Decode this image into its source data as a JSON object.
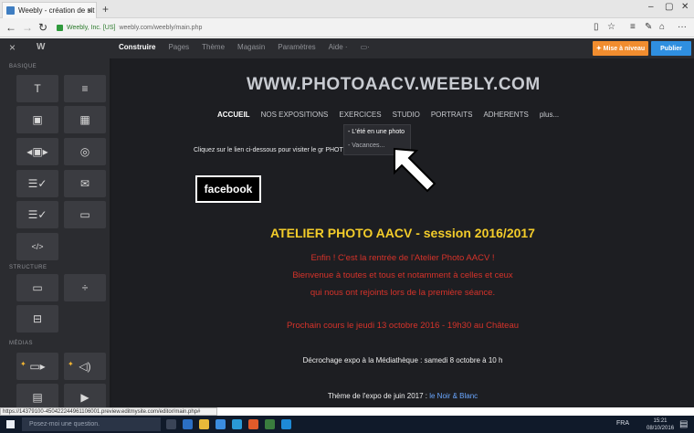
{
  "browser": {
    "tab_title": "Weebly - création de sit",
    "tab_close": "×",
    "new_tab": "+",
    "url_site": "Weebly, Inc. [US]",
    "url_path": "weebly.com/weebly/main.php",
    "status_url": "https://14379100-450422244961106001.preview.editmysite.com/editor/main.php#"
  },
  "weebly": {
    "close": "×",
    "logo": "W",
    "nav": [
      "Construire",
      "Pages",
      "Thème",
      "Magasin",
      "Paramètres",
      "Aide ·"
    ],
    "upgrade": "✦ Mise à niveau",
    "publish": "Publier"
  },
  "sidebar": {
    "sections": [
      "BASIQUE",
      "STRUCTURE",
      "MÉDIAS"
    ]
  },
  "site": {
    "title": "WWW.PHOTOAACV.WEEBLY.COM",
    "nav": [
      "ACCUEIL",
      "NOS EXPOSITIONS",
      "EXERCICES",
      "STUDIO",
      "PORTRAITS",
      "ADHERENTS",
      "plus..."
    ],
    "dropdown": [
      "- L'été en une photo",
      "- Vacances..."
    ],
    "intro": "Cliquez sur le lien ci-dessous pour visiter le gr                               PHOTO\" (groupe fermé)",
    "facebook": "facebook",
    "heading": "ATELIER PHOTO AACV - session 2016/2017",
    "red_lines": [
      "Enfin ! C'est la rentrée de l'Atelier Photo AACV !",
      "Bienvenue à toutes et tous et notamment à celles et ceux",
      "qui nous ont rejoints lors de la première séance.",
      "Prochain cours le jeudi 13 octobre 2016 - 19h30 au Château"
    ],
    "decrochage": "Décrochage expo à la Médiathèque : samedi 8 octobre à 10 h",
    "theme_prefix": "Thème de l'expo de juin 2017 : ",
    "theme_link": "le Noir & Blanc"
  },
  "taskbar": {
    "search_placeholder": "Posez-moi une question.",
    "tray": "FRA",
    "time": "15:21",
    "date": "08/10/2016"
  }
}
